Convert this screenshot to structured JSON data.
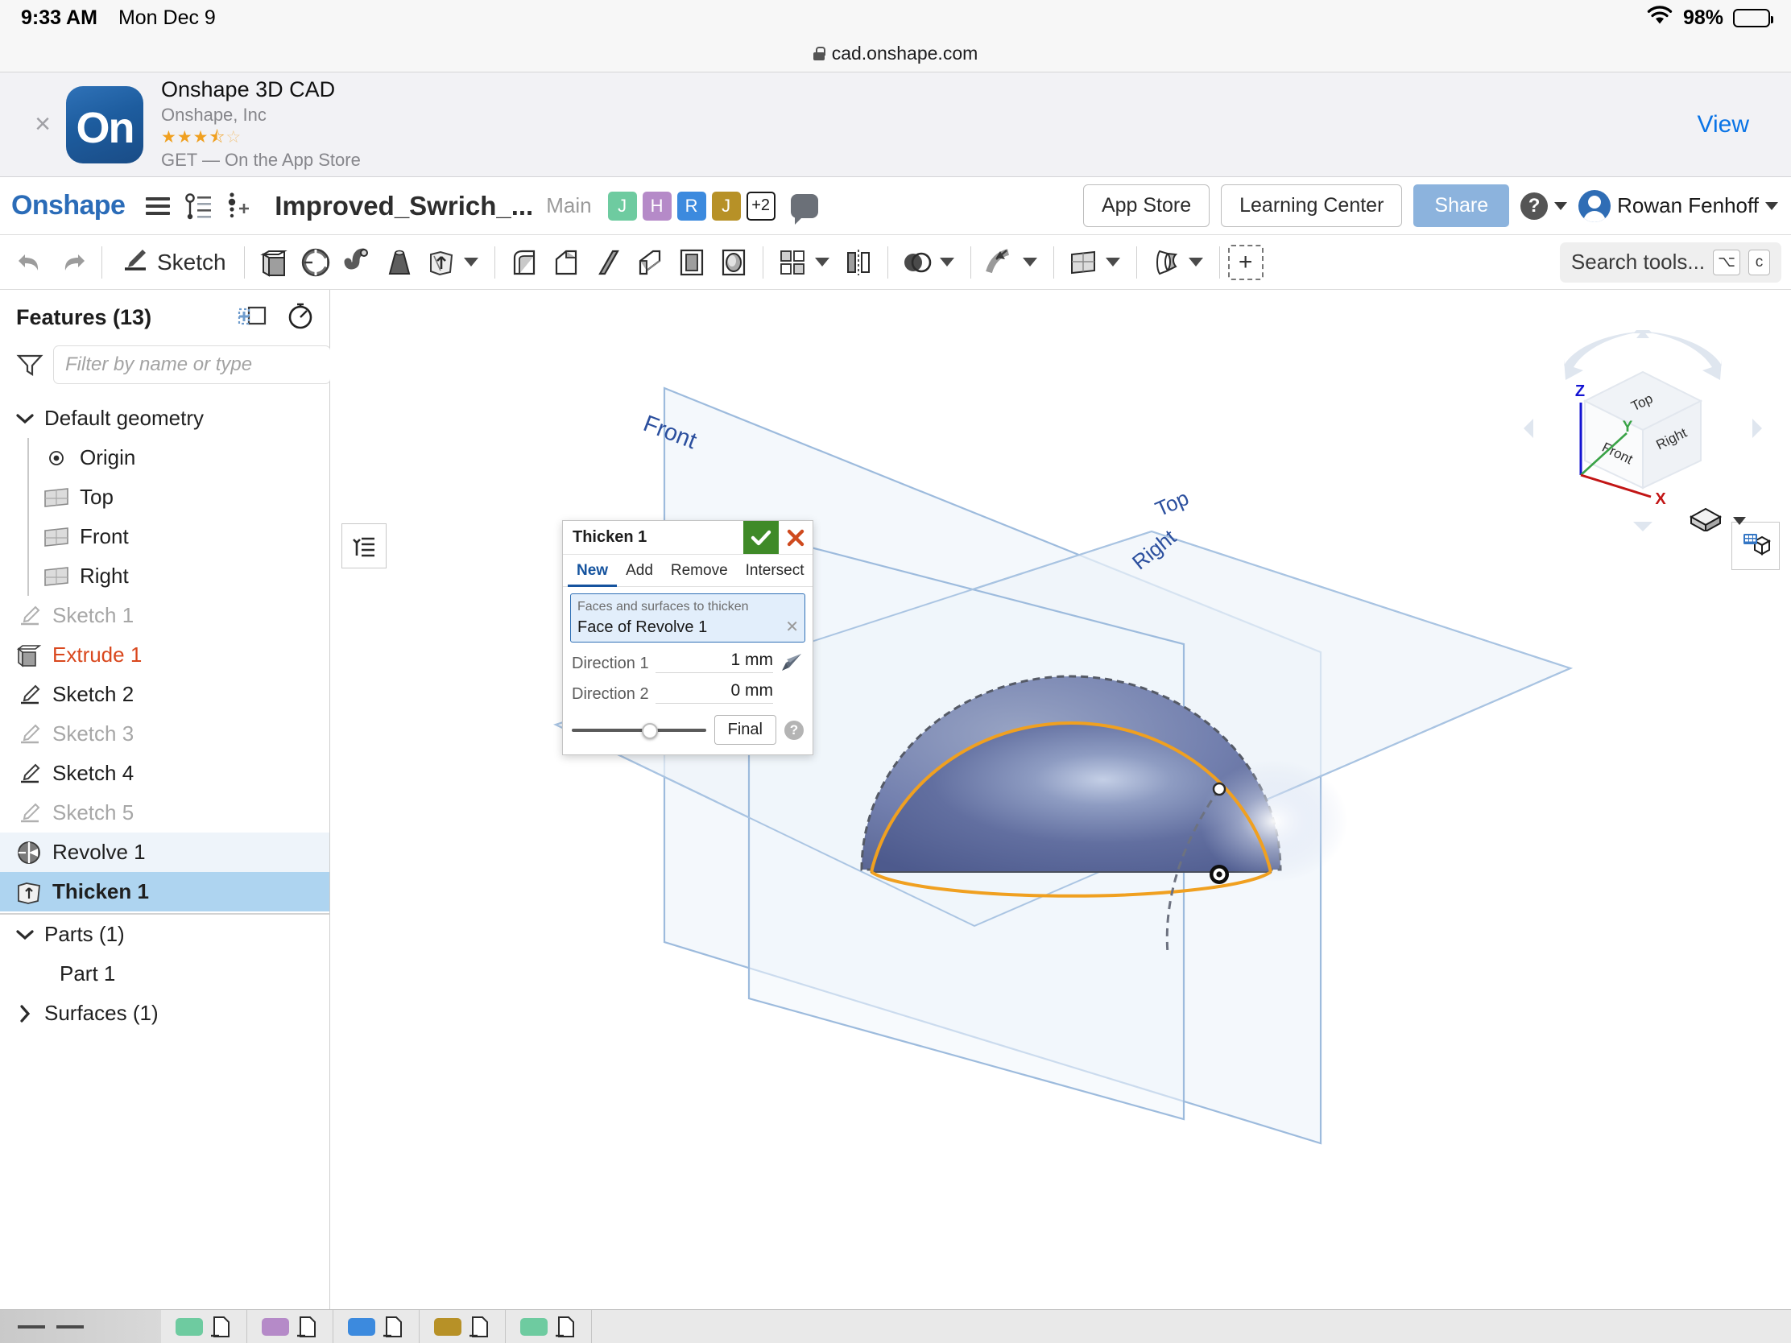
{
  "status_bar": {
    "time": "9:33 AM",
    "date": "Mon Dec 9",
    "battery_percent": "98%",
    "wifi_icon": "wifi-icon",
    "battery_icon": "battery-icon"
  },
  "browser": {
    "url": "cad.onshape.com",
    "lock_icon": "lock-icon"
  },
  "app_banner": {
    "close_label": "×",
    "icon_text": "On",
    "app_name": "Onshape 3D CAD",
    "developer": "Onshape, Inc",
    "stars_filled": "★★★",
    "stars_half": "⯪",
    "stars_empty": "☆",
    "cta": "GET — On the App Store",
    "view_label": "View"
  },
  "header": {
    "logo": "Onshape",
    "menu_icon": "hamburger-menu-icon",
    "version_graph_icon": "version-graph-icon",
    "insert_icon": "insert-feature-icon",
    "document_title": "Improved_Swrich_...",
    "branch": "Main",
    "collaborators": [
      {
        "initial": "J",
        "color": "#6ecba0"
      },
      {
        "initial": "H",
        "color": "#b58ac8"
      },
      {
        "initial": "R",
        "color": "#3c8ade"
      },
      {
        "initial": "J",
        "color": "#b79127"
      }
    ],
    "collaborators_overflow": "+2",
    "comment_icon": "comment-bubble-icon",
    "app_store_label": "App Store",
    "learning_center_label": "Learning Center",
    "share_label": "Share",
    "help_icon": "help-icon",
    "user_name": "Rowan Fenhoff",
    "user_avatar": "user-avatar-icon",
    "share_color": "#8cb3dd",
    "logo_color": "#2b6cb8"
  },
  "toolbar": {
    "undo_icon": "undo-icon",
    "redo_icon": "redo-icon",
    "sketch_label": "Sketch",
    "sketch_icon": "sketch-pencil-icon",
    "tools": [
      "extrude-icon",
      "revolve-icon",
      "sweep-icon",
      "loft-icon",
      "thicken-icon",
      "fillet-icon",
      "chamfer-icon",
      "rib-icon",
      "shell-icon",
      "draft-icon",
      "hole-icon",
      "pattern-icon",
      "mirror-icon",
      "boolean-icon",
      "transform-icon",
      "plane-icon",
      "surface-icon"
    ],
    "add_custom_icon": "add-custom-feature-icon",
    "search_placeholder": "Search tools...",
    "search_shortcut_1": "⌥",
    "search_shortcut_2": "c"
  },
  "feature_tree": {
    "title": "Features (13)",
    "new_folder_icon": "new-folder-icon",
    "rollback_icon": "rollback-timer-icon",
    "filter_icon": "funnel-filter-icon",
    "filter_placeholder": "Filter by name or type",
    "filter_value": "",
    "default_geometry": {
      "label": "Default geometry",
      "expanded": true,
      "items": [
        {
          "label": "Origin",
          "icon": "origin-icon"
        },
        {
          "label": "Top",
          "icon": "plane-icon"
        },
        {
          "label": "Front",
          "icon": "plane-icon"
        },
        {
          "label": "Right",
          "icon": "plane-icon"
        }
      ]
    },
    "features": [
      {
        "label": "Sketch 1",
        "icon": "sketch-icon",
        "state": "suppressed"
      },
      {
        "label": "Extrude 1",
        "icon": "extrude-icon",
        "state": "error"
      },
      {
        "label": "Sketch 2",
        "icon": "sketch-icon",
        "state": "normal"
      },
      {
        "label": "Sketch 3",
        "icon": "sketch-icon",
        "state": "suppressed"
      },
      {
        "label": "Sketch 4",
        "icon": "sketch-icon",
        "state": "normal"
      },
      {
        "label": "Sketch 5",
        "icon": "sketch-icon",
        "state": "suppressed"
      },
      {
        "label": "Revolve 1",
        "icon": "revolve-icon",
        "state": "hover"
      },
      {
        "label": "Thicken 1",
        "icon": "thicken-icon",
        "state": "selected"
      }
    ],
    "parts": {
      "label": "Parts (1)",
      "expanded": true,
      "items": [
        {
          "label": "Part 1"
        }
      ]
    },
    "surfaces": {
      "label": "Surfaces (1)",
      "expanded": false
    }
  },
  "thicken_dialog": {
    "title": "Thicken 1",
    "accept_icon": "checkmark-icon",
    "cancel_icon": "close-x-icon",
    "accept_color": "#3f8a28",
    "cancel_color": "#cf4a1e",
    "tabs": [
      {
        "label": "New",
        "active": true
      },
      {
        "label": "Add",
        "active": false
      },
      {
        "label": "Remove",
        "active": false
      },
      {
        "label": "Intersect",
        "active": false
      }
    ],
    "selection_field": {
      "label": "Faces and surfaces to thicken",
      "value": "Face of Revolve 1",
      "clear_icon": "clear-x-icon"
    },
    "direction_1": {
      "label": "Direction 1",
      "value": "1 mm",
      "flip_icon": "flip-direction-icon"
    },
    "direction_2": {
      "label": "Direction 2",
      "value": "0 mm"
    },
    "slider_position_percent": 58,
    "quality_label": "Final",
    "help_icon": "help-question-icon"
  },
  "viewport": {
    "planes": [
      {
        "name": "Front",
        "label": "Front"
      },
      {
        "name": "Top",
        "label": "Top"
      },
      {
        "name": "Right",
        "label": "Right"
      }
    ],
    "plane_label_color": "#2b4f9e",
    "selected_edge_color": "#f0a020",
    "part_color": "#5c6b9c",
    "feature_list_toggle_icon": "feature-list-toggle-icon",
    "display_state_icon": "display-state-icon"
  },
  "view_cube": {
    "faces": {
      "top": "Top",
      "front": "Front",
      "right": "Right"
    },
    "axes": [
      {
        "label": "Z",
        "color": "#1414d2"
      },
      {
        "label": "Y",
        "color": "#3aa347"
      },
      {
        "label": "X",
        "color": "#c21515"
      }
    ],
    "view_mode_icon": "shaded-cube-icon",
    "view_mode_caret": "chevron-down-icon"
  },
  "bottom_tabs": {
    "grip_icon": "drag-grip-icon",
    "tabs": [
      {
        "chip_color": "#6ecba0",
        "icon": "tab-sheet-icon"
      },
      {
        "chip_color": "#b58ac8",
        "icon": "tab-sheet-icon"
      },
      {
        "chip_color": "#3c8ade",
        "icon": "tab-sheet-icon"
      },
      {
        "chip_color": "#b79127",
        "icon": "tab-sheet-icon"
      },
      {
        "chip_color": "#6ecba0",
        "icon": "tab-sheet-icon"
      }
    ]
  }
}
